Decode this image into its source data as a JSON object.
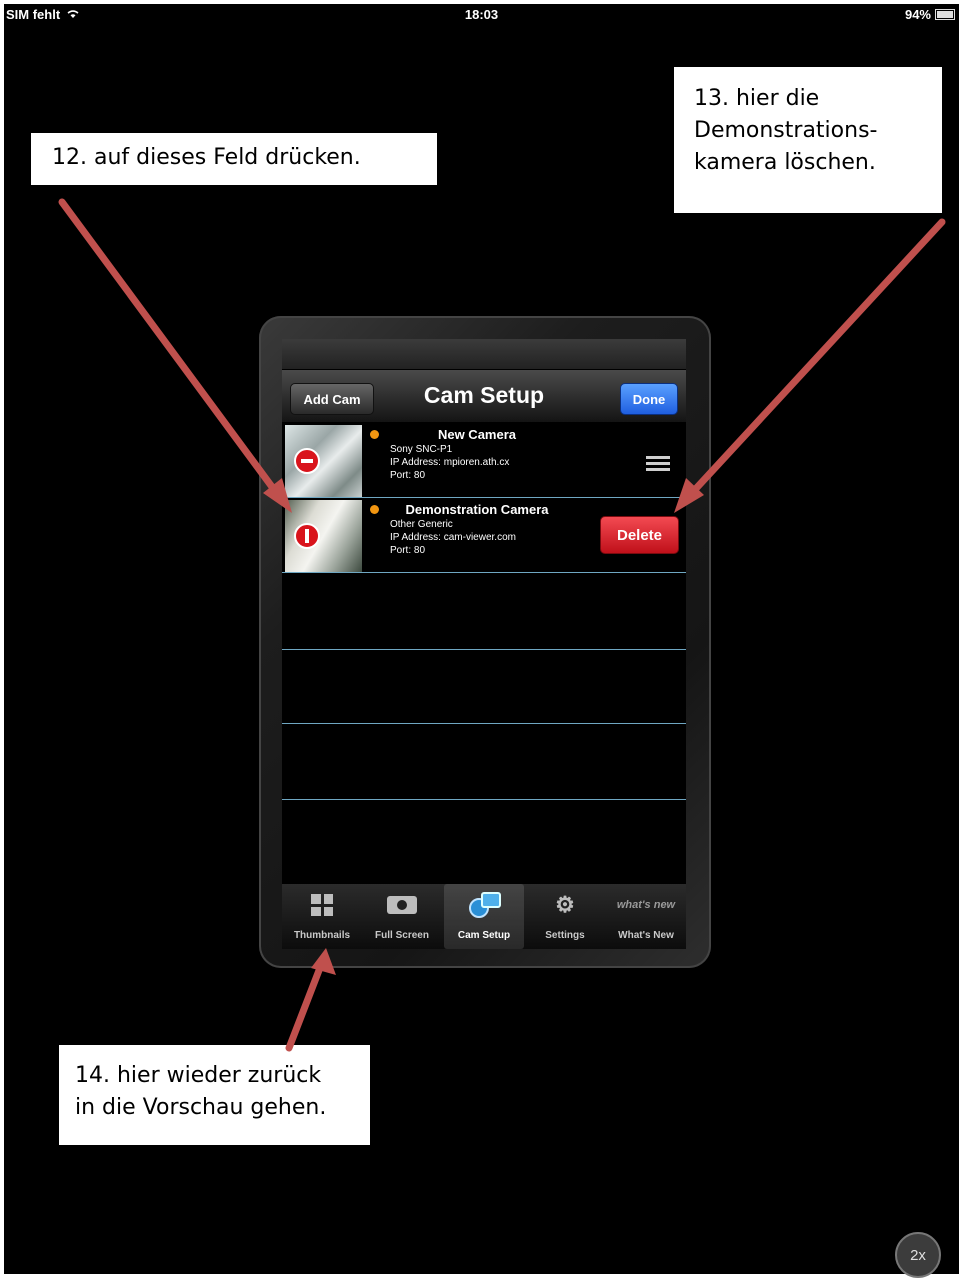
{
  "status_bar": {
    "carrier": "SIM fehlt",
    "wifi_icon": "wifi-icon",
    "time": "18:03",
    "battery": "94%"
  },
  "callouts": {
    "step12": [
      "12. auf dieses Feld drücken."
    ],
    "step13": [
      "13. hier die",
      "Demonstrations-",
      "kamera löschen."
    ],
    "step14": [
      "14. hier wieder zurück",
      "in die Vorschau gehen."
    ]
  },
  "app": {
    "navbar": {
      "title": "Cam Setup",
      "add_label": "Add Cam",
      "done_label": "Done"
    },
    "cameras": [
      {
        "name": "New Camera",
        "model": "Sony SNC-P1",
        "ip": "IP Address: mpioren.ath.cx",
        "port": "Port: 80",
        "status_color": "#f29611"
      },
      {
        "name": "Demonstration Camera",
        "model": "Other Generic",
        "ip": "IP Address: cam-viewer.com",
        "port": "Port: 80",
        "status_color": "#f29611",
        "delete_label": "Delete"
      }
    ],
    "tabs": [
      {
        "label": "Thumbnails",
        "icon": "grid-icon"
      },
      {
        "label": "Full Screen",
        "icon": "camera-icon"
      },
      {
        "label": "Cam Setup",
        "icon": "cam-setup-icon",
        "active": true
      },
      {
        "label": "Settings",
        "icon": "gears-icon"
      },
      {
        "label": "What's New",
        "icon": "whats-new-icon",
        "icon_text": "what's new"
      }
    ]
  },
  "zoom_badge": "2x",
  "colors": {
    "arrow": "#c0504d",
    "done_button": "#2a6ef0",
    "delete_button": "#e02b33",
    "row_divider": "#6fa7c2"
  }
}
